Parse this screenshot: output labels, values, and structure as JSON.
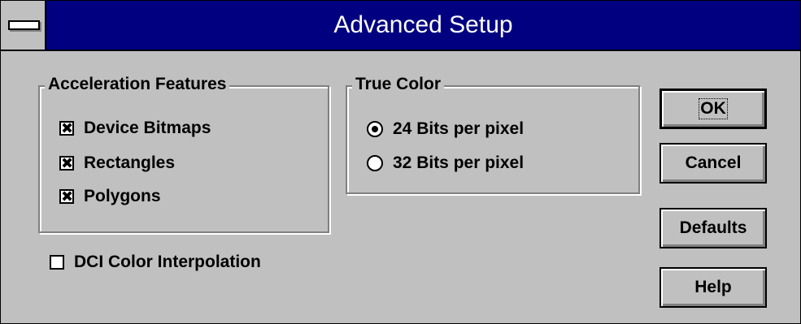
{
  "window": {
    "title": "Advanced Setup"
  },
  "acceleration": {
    "title": "Acceleration Features",
    "items": [
      {
        "label": "Device Bitmaps",
        "checked": true
      },
      {
        "label": "Rectangles",
        "checked": true
      },
      {
        "label": "Polygons",
        "checked": true
      }
    ]
  },
  "dci": {
    "label": "DCI Color Interpolation",
    "checked": false
  },
  "true_color": {
    "title": "True Color",
    "options": [
      {
        "label": "24 Bits per pixel",
        "selected": true
      },
      {
        "label": "32 Bits per pixel",
        "selected": false
      }
    ]
  },
  "buttons": {
    "ok": "OK",
    "cancel": "Cancel",
    "defaults": "Defaults",
    "help": "Help"
  },
  "check_mark": "✖"
}
